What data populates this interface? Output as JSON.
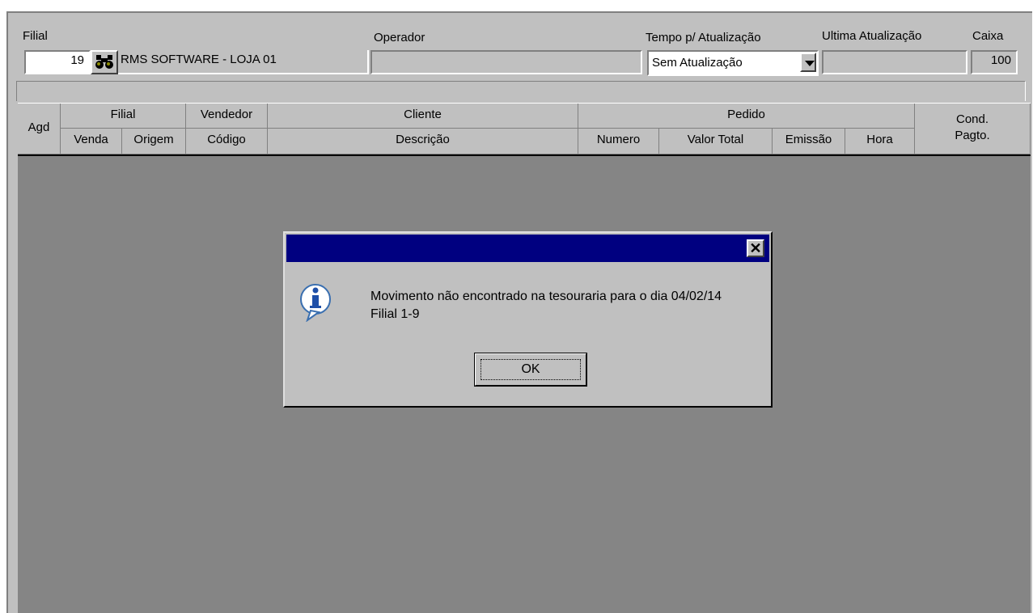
{
  "filters": {
    "filial_label": "Filial",
    "filial_code": "19",
    "filial_name": "RMS SOFTWARE - LOJA 01",
    "operador_label": "Operador",
    "operador_value": "",
    "tempo_label": "Tempo p/ Atualização",
    "tempo_value": "Sem Atualização",
    "ultima_label": "Ultima Atualização",
    "ultima_value": "",
    "caixa_label": "Caixa",
    "caixa_value": "100"
  },
  "table": {
    "agd": "Agd",
    "group_filial": "Filial",
    "group_vendedor": "Vendedor",
    "group_cliente": "Cliente",
    "group_pedido": "Pedido",
    "cond_line1": "Cond.",
    "cond_line2": "Pagto.",
    "col_venda": "Venda",
    "col_origem": "Origem",
    "col_codigo": "Código",
    "col_descricao": "Descrição",
    "col_numero": "Numero",
    "col_valor": "Valor Total",
    "col_emissao": "Emissão",
    "col_hora": "Hora"
  },
  "dialog": {
    "icon": "info-icon",
    "message_line1": "Movimento não encontrado na tesouraria para o dia 04/02/14",
    "message_line2": "Filial 1-9",
    "ok_label": "OK"
  },
  "colors": {
    "window_bg": "#c0c0c0",
    "grid_bg": "#858585",
    "title_bar": "#000080"
  }
}
